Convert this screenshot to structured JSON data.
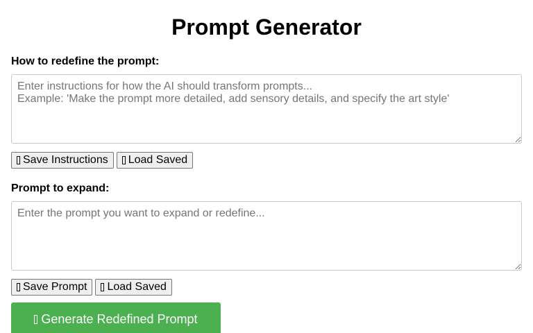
{
  "page": {
    "title": "Prompt Generator"
  },
  "instructions": {
    "label": "How to redefine the prompt:",
    "placeholder": "Enter instructions for how the AI should transform prompts...\nExample: 'Make the prompt more detailed, add sensory details, and specify the art style'",
    "value": "",
    "save_label": "Save Instructions",
    "load_label": "Load Saved",
    "save_icon": "missing-glyph-icon",
    "load_icon": "missing-glyph-icon"
  },
  "prompt": {
    "label": "Prompt to expand:",
    "placeholder": "Enter the prompt you want to expand or redefine...",
    "value": "",
    "save_label": "Save Prompt",
    "load_label": "Load Saved",
    "save_icon": "missing-glyph-icon",
    "load_icon": "missing-glyph-icon"
  },
  "generate": {
    "label": "Generate Redefined Prompt",
    "icon": "missing-glyph-icon",
    "color": "#4caf50"
  }
}
